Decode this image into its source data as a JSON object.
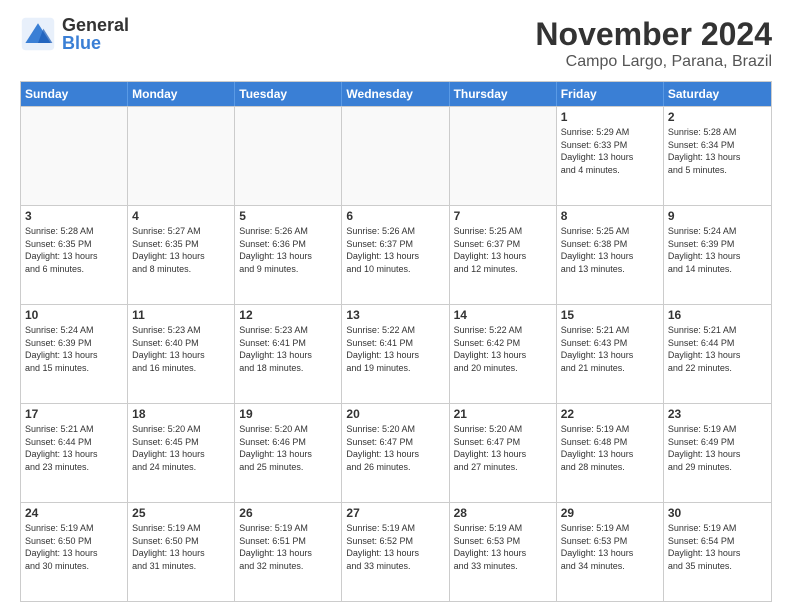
{
  "logo": {
    "general": "General",
    "blue": "Blue"
  },
  "title": "November 2024",
  "subtitle": "Campo Largo, Parana, Brazil",
  "headers": [
    "Sunday",
    "Monday",
    "Tuesday",
    "Wednesday",
    "Thursday",
    "Friday",
    "Saturday"
  ],
  "rows": [
    [
      {
        "day": "",
        "info": "",
        "empty": true
      },
      {
        "day": "",
        "info": "",
        "empty": true
      },
      {
        "day": "",
        "info": "",
        "empty": true
      },
      {
        "day": "",
        "info": "",
        "empty": true
      },
      {
        "day": "",
        "info": "",
        "empty": true
      },
      {
        "day": "1",
        "info": "Sunrise: 5:29 AM\nSunset: 6:33 PM\nDaylight: 13 hours\nand 4 minutes."
      },
      {
        "day": "2",
        "info": "Sunrise: 5:28 AM\nSunset: 6:34 PM\nDaylight: 13 hours\nand 5 minutes."
      }
    ],
    [
      {
        "day": "3",
        "info": "Sunrise: 5:28 AM\nSunset: 6:35 PM\nDaylight: 13 hours\nand 6 minutes."
      },
      {
        "day": "4",
        "info": "Sunrise: 5:27 AM\nSunset: 6:35 PM\nDaylight: 13 hours\nand 8 minutes."
      },
      {
        "day": "5",
        "info": "Sunrise: 5:26 AM\nSunset: 6:36 PM\nDaylight: 13 hours\nand 9 minutes."
      },
      {
        "day": "6",
        "info": "Sunrise: 5:26 AM\nSunset: 6:37 PM\nDaylight: 13 hours\nand 10 minutes."
      },
      {
        "day": "7",
        "info": "Sunrise: 5:25 AM\nSunset: 6:37 PM\nDaylight: 13 hours\nand 12 minutes."
      },
      {
        "day": "8",
        "info": "Sunrise: 5:25 AM\nSunset: 6:38 PM\nDaylight: 13 hours\nand 13 minutes."
      },
      {
        "day": "9",
        "info": "Sunrise: 5:24 AM\nSunset: 6:39 PM\nDaylight: 13 hours\nand 14 minutes."
      }
    ],
    [
      {
        "day": "10",
        "info": "Sunrise: 5:24 AM\nSunset: 6:39 PM\nDaylight: 13 hours\nand 15 minutes."
      },
      {
        "day": "11",
        "info": "Sunrise: 5:23 AM\nSunset: 6:40 PM\nDaylight: 13 hours\nand 16 minutes."
      },
      {
        "day": "12",
        "info": "Sunrise: 5:23 AM\nSunset: 6:41 PM\nDaylight: 13 hours\nand 18 minutes."
      },
      {
        "day": "13",
        "info": "Sunrise: 5:22 AM\nSunset: 6:41 PM\nDaylight: 13 hours\nand 19 minutes."
      },
      {
        "day": "14",
        "info": "Sunrise: 5:22 AM\nSunset: 6:42 PM\nDaylight: 13 hours\nand 20 minutes."
      },
      {
        "day": "15",
        "info": "Sunrise: 5:21 AM\nSunset: 6:43 PM\nDaylight: 13 hours\nand 21 minutes."
      },
      {
        "day": "16",
        "info": "Sunrise: 5:21 AM\nSunset: 6:44 PM\nDaylight: 13 hours\nand 22 minutes."
      }
    ],
    [
      {
        "day": "17",
        "info": "Sunrise: 5:21 AM\nSunset: 6:44 PM\nDaylight: 13 hours\nand 23 minutes."
      },
      {
        "day": "18",
        "info": "Sunrise: 5:20 AM\nSunset: 6:45 PM\nDaylight: 13 hours\nand 24 minutes."
      },
      {
        "day": "19",
        "info": "Sunrise: 5:20 AM\nSunset: 6:46 PM\nDaylight: 13 hours\nand 25 minutes."
      },
      {
        "day": "20",
        "info": "Sunrise: 5:20 AM\nSunset: 6:47 PM\nDaylight: 13 hours\nand 26 minutes."
      },
      {
        "day": "21",
        "info": "Sunrise: 5:20 AM\nSunset: 6:47 PM\nDaylight: 13 hours\nand 27 minutes."
      },
      {
        "day": "22",
        "info": "Sunrise: 5:19 AM\nSunset: 6:48 PM\nDaylight: 13 hours\nand 28 minutes."
      },
      {
        "day": "23",
        "info": "Sunrise: 5:19 AM\nSunset: 6:49 PM\nDaylight: 13 hours\nand 29 minutes."
      }
    ],
    [
      {
        "day": "24",
        "info": "Sunrise: 5:19 AM\nSunset: 6:50 PM\nDaylight: 13 hours\nand 30 minutes."
      },
      {
        "day": "25",
        "info": "Sunrise: 5:19 AM\nSunset: 6:50 PM\nDaylight: 13 hours\nand 31 minutes."
      },
      {
        "day": "26",
        "info": "Sunrise: 5:19 AM\nSunset: 6:51 PM\nDaylight: 13 hours\nand 32 minutes."
      },
      {
        "day": "27",
        "info": "Sunrise: 5:19 AM\nSunset: 6:52 PM\nDaylight: 13 hours\nand 33 minutes."
      },
      {
        "day": "28",
        "info": "Sunrise: 5:19 AM\nSunset: 6:53 PM\nDaylight: 13 hours\nand 33 minutes."
      },
      {
        "day": "29",
        "info": "Sunrise: 5:19 AM\nSunset: 6:53 PM\nDaylight: 13 hours\nand 34 minutes."
      },
      {
        "day": "30",
        "info": "Sunrise: 5:19 AM\nSunset: 6:54 PM\nDaylight: 13 hours\nand 35 minutes."
      }
    ]
  ]
}
